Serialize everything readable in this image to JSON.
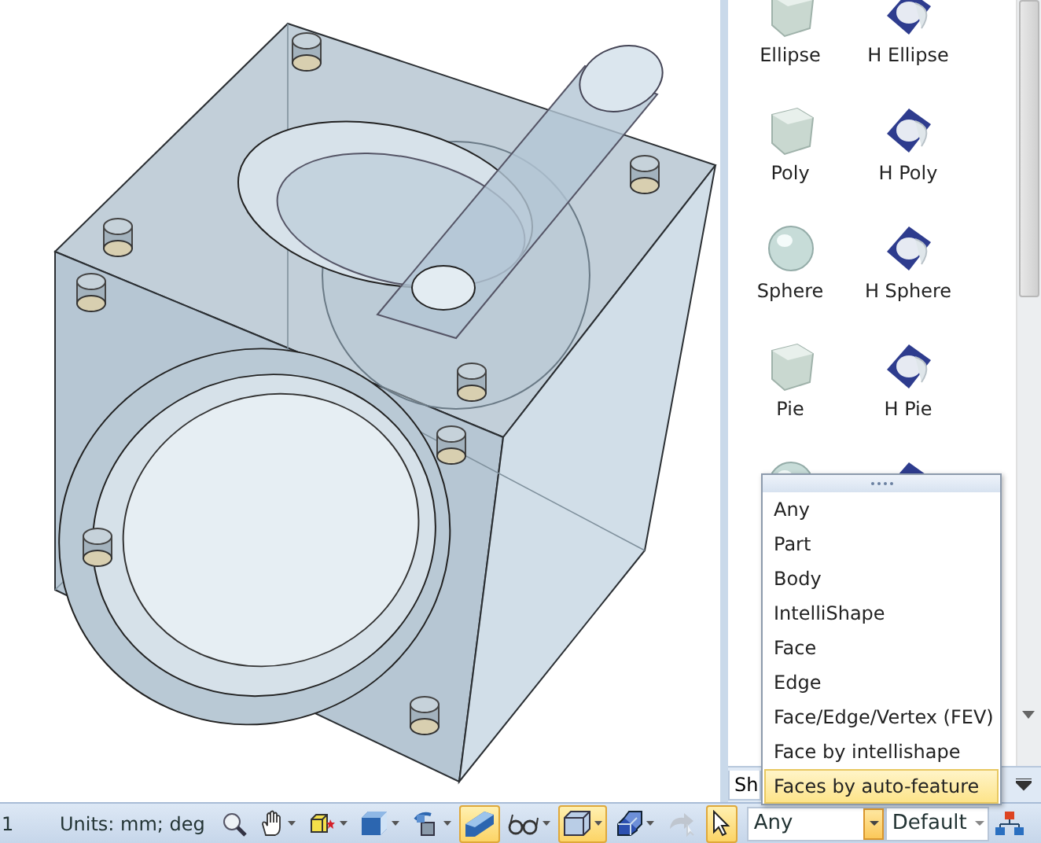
{
  "catalog": {
    "items": [
      {
        "label": "Ellipse",
        "kind": "solid"
      },
      {
        "label": "H Ellipse",
        "kind": "hollow"
      },
      {
        "label": "Poly",
        "kind": "solid"
      },
      {
        "label": "H Poly",
        "kind": "hollow"
      },
      {
        "label": "Sphere",
        "kind": "sphere"
      },
      {
        "label": "H Sphere",
        "kind": "hollow"
      },
      {
        "label": "Pie",
        "kind": "solid"
      },
      {
        "label": "H Pie",
        "kind": "hollow"
      },
      {
        "kind": "sphere"
      },
      {
        "kind": "hollow"
      }
    ],
    "tab": "Sh"
  },
  "dropdown": {
    "items": [
      {
        "label": "Any",
        "selected": false
      },
      {
        "label": "Part",
        "selected": false
      },
      {
        "label": "Body",
        "selected": false
      },
      {
        "label": "IntelliShape",
        "selected": false
      },
      {
        "label": "Face",
        "selected": false
      },
      {
        "label": "Edge",
        "selected": false
      },
      {
        "label": "Face/Edge/Vertex (FEV)",
        "selected": false
      },
      {
        "label": "Face by intellishape",
        "selected": false
      },
      {
        "label": "Faces by auto-feature",
        "selected": true
      }
    ]
  },
  "status_bar": {
    "page": "1",
    "units": "Units: mm; deg",
    "tools": [
      {
        "kind": "zoom",
        "active": false,
        "dropdown": false,
        "disabled": false
      },
      {
        "kind": "hand",
        "active": false,
        "dropdown": true,
        "disabled": false
      },
      {
        "kind": "cube-star",
        "active": false,
        "dropdown": true,
        "disabled": false
      },
      {
        "kind": "cube",
        "active": false,
        "dropdown": true,
        "disabled": false
      },
      {
        "kind": "clone",
        "active": false,
        "dropdown": true,
        "disabled": false
      },
      {
        "kind": "wedge",
        "active": true,
        "dropdown": false,
        "disabled": false
      },
      {
        "kind": "glasses",
        "active": false,
        "dropdown": true,
        "disabled": false
      },
      {
        "kind": "frame",
        "active": true,
        "dropdown": true,
        "disabled": false
      },
      {
        "kind": "blocks",
        "active": false,
        "dropdown": true,
        "disabled": false
      },
      {
        "kind": "arrow",
        "active": false,
        "dropdown": false,
        "disabled": true
      },
      {
        "kind": "cursor",
        "active": true,
        "dropdown": false,
        "disabled": false
      }
    ],
    "filter": {
      "value": "Any",
      "open": true
    },
    "style": {
      "value": "Default",
      "open": false
    }
  }
}
